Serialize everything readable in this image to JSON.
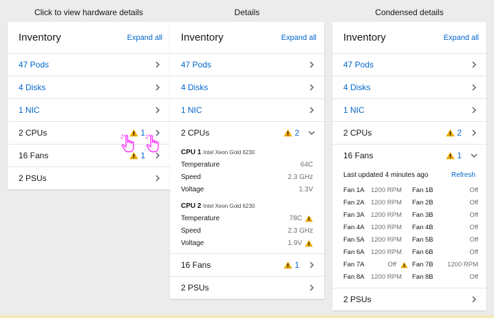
{
  "colors": {
    "link": "#0066cc",
    "warning": "#f0ab00",
    "cursor": "#ff30ff"
  },
  "col1": {
    "title": "Click to view hardware details",
    "card_title": "Inventory",
    "expand": "Expand all",
    "rows": [
      {
        "label": "47 Pods"
      },
      {
        "label": "4 Disks"
      },
      {
        "label": "1 NIC"
      },
      {
        "label": "2 CPUs",
        "warn": "1"
      },
      {
        "label": "16 Fans",
        "warn": "1"
      },
      {
        "label": "2 PSUs"
      }
    ]
  },
  "col2": {
    "title": "Details",
    "card_title": "Inventory",
    "expand": "Expand all",
    "rows": [
      {
        "label": "47 Pods"
      },
      {
        "label": "4 Disks"
      },
      {
        "label": "1 NIC"
      },
      {
        "label": "2 CPUs",
        "warn": "2"
      },
      {
        "label": "16 Fans",
        "warn": "1"
      },
      {
        "label": "2 PSUs"
      }
    ],
    "cpus": [
      {
        "name": "CPU 1",
        "model": "Intel Xeon Gold 6230",
        "metrics": [
          {
            "label": "Temperature",
            "value": "64C"
          },
          {
            "label": "Speed",
            "value": "2.3 GHz"
          },
          {
            "label": "Voltage",
            "value": "1.3V"
          }
        ]
      },
      {
        "name": "CPU 2",
        "model": "Intel Xeon Gold 6230",
        "metrics": [
          {
            "label": "Temperature",
            "value": "78C"
          },
          {
            "label": "Speed",
            "value": "2.3 GHz"
          },
          {
            "label": "Voltage",
            "value": "1.9V"
          }
        ]
      }
    ]
  },
  "col3": {
    "title": "Condensed details",
    "card_title": "Inventory",
    "expand": "Expand all",
    "rows": [
      {
        "label": "47 Pods"
      },
      {
        "label": "4 Disks"
      },
      {
        "label": "1 NIC"
      },
      {
        "label": "2 CPUs",
        "warn": "2"
      },
      {
        "label": "16 Fans",
        "warn": "1"
      },
      {
        "label": "2 PSUs"
      }
    ],
    "updated": "Last updated 4 minutes ago",
    "refresh": "Refresh",
    "fans": [
      [
        "Fan 1A",
        "1200 RPM",
        "Fan 1B",
        "Off"
      ],
      [
        "Fan 2A",
        "1200 RPM",
        "Fan 2B",
        "Off"
      ],
      [
        "Fan 3A",
        "1200 RPM",
        "Fan 3B",
        "Off"
      ],
      [
        "Fan 4A",
        "1200 RPM",
        "Fan 4B",
        "Off"
      ],
      [
        "Fan 5A",
        "1200 RPM",
        "Fan 5B",
        "Off"
      ],
      [
        "Fan 6A",
        "1200 RPM",
        "Fan 6B",
        "Off"
      ],
      [
        "Fan 7A",
        "Off",
        "Fan 7B",
        "1200 RPM"
      ],
      [
        "Fan 8A",
        "1200 RPM",
        "Fan 8B",
        "Off"
      ]
    ]
  }
}
